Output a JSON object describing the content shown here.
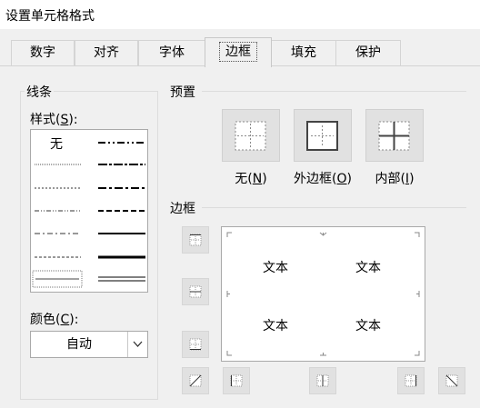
{
  "window": {
    "title": "设置单元格格式"
  },
  "tabs": [
    {
      "label": "数字"
    },
    {
      "label": "对齐"
    },
    {
      "label": "字体"
    },
    {
      "label": "边框",
      "active": true
    },
    {
      "label": "填充"
    },
    {
      "label": "保护"
    }
  ],
  "line": {
    "group_title": "线条",
    "style_label": "样式(",
    "style_key": "S",
    "style_suffix": "):",
    "style_none": "无",
    "color_label": "颜色(",
    "color_key": "C",
    "color_suffix": "):",
    "color_value": "自动"
  },
  "presets": {
    "title": "预置",
    "items": [
      {
        "label": "无(",
        "key": "N",
        "suffix": ")"
      },
      {
        "label": "外边框(",
        "key": "O",
        "suffix": ")"
      },
      {
        "label": "内部(",
        "key": "I",
        "suffix": ")"
      }
    ]
  },
  "border": {
    "title": "边框",
    "preview_texts": [
      "文本",
      "文本",
      "文本",
      "文本"
    ]
  },
  "colors": {
    "accent": "#2b579a",
    "button_face": "#e1e1e1",
    "dialog_bg": "#f0f0f0"
  }
}
